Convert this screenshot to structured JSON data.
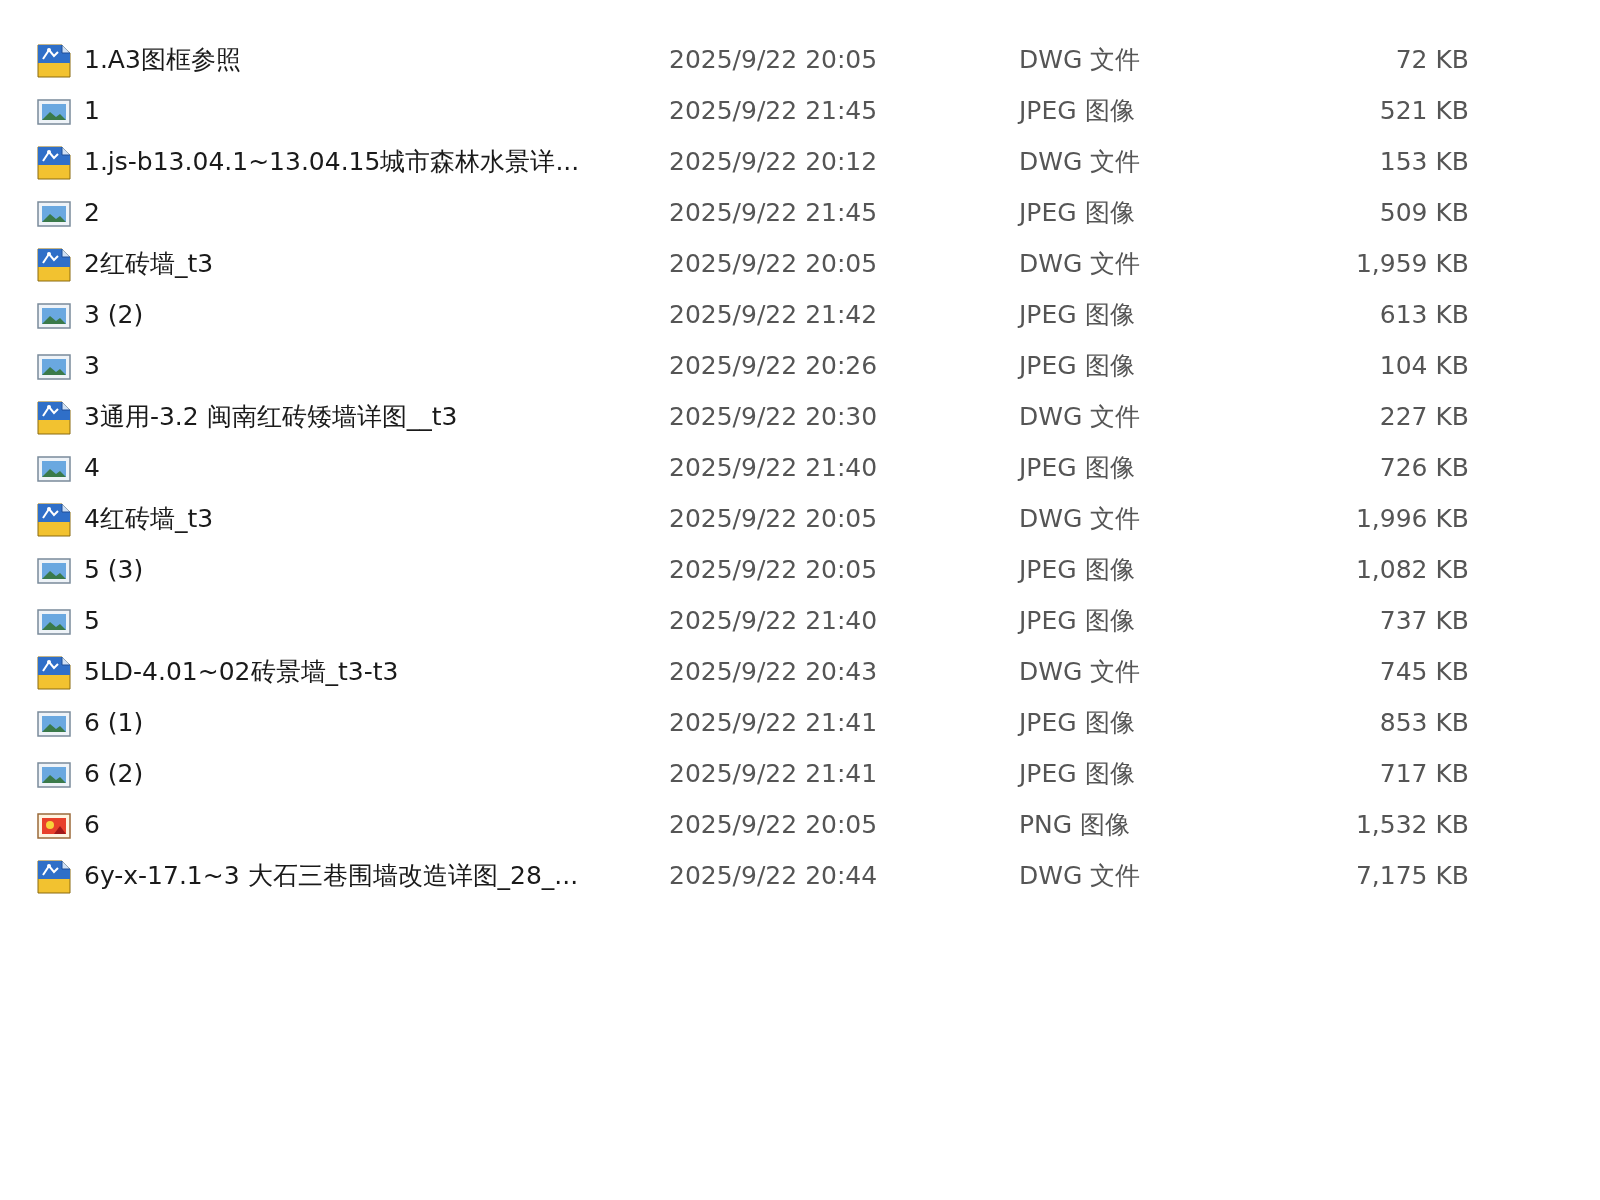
{
  "files": [
    {
      "kind": "dwg",
      "name": "1.A3图框参照",
      "date": "2025/9/22 20:05",
      "type": "DWG 文件",
      "size": "72 KB"
    },
    {
      "kind": "jpeg",
      "name": "1",
      "date": "2025/9/22 21:45",
      "type": "JPEG 图像",
      "size": "521 KB"
    },
    {
      "kind": "dwg",
      "name": "1.js-b13.04.1~13.04.15城市森林水景详...",
      "date": "2025/9/22 20:12",
      "type": "DWG 文件",
      "size": "153 KB"
    },
    {
      "kind": "jpeg",
      "name": "2",
      "date": "2025/9/22 21:45",
      "type": "JPEG 图像",
      "size": "509 KB"
    },
    {
      "kind": "dwg",
      "name": "2红砖墙_t3",
      "date": "2025/9/22 20:05",
      "type": "DWG 文件",
      "size": "1,959 KB"
    },
    {
      "kind": "jpeg",
      "name": "3 (2)",
      "date": "2025/9/22 21:42",
      "type": "JPEG 图像",
      "size": "613 KB"
    },
    {
      "kind": "jpeg",
      "name": "3",
      "date": "2025/9/22 20:26",
      "type": "JPEG 图像",
      "size": "104 KB"
    },
    {
      "kind": "dwg",
      "name": "3通用-3.2 闽南红砖矮墙详图__t3",
      "date": "2025/9/22 20:30",
      "type": "DWG 文件",
      "size": "227 KB"
    },
    {
      "kind": "jpeg",
      "name": "4",
      "date": "2025/9/22 21:40",
      "type": "JPEG 图像",
      "size": "726 KB"
    },
    {
      "kind": "dwg",
      "name": "4红砖墙_t3",
      "date": "2025/9/22 20:05",
      "type": "DWG 文件",
      "size": "1,996 KB"
    },
    {
      "kind": "jpeg",
      "name": "5 (3)",
      "date": "2025/9/22 20:05",
      "type": "JPEG 图像",
      "size": "1,082 KB"
    },
    {
      "kind": "jpeg",
      "name": "5",
      "date": "2025/9/22 21:40",
      "type": "JPEG 图像",
      "size": "737 KB"
    },
    {
      "kind": "dwg",
      "name": "5LD-4.01~02砖景墙_t3-t3",
      "date": "2025/9/22 20:43",
      "type": "DWG 文件",
      "size": "745 KB"
    },
    {
      "kind": "jpeg",
      "name": "6 (1)",
      "date": "2025/9/22 21:41",
      "type": "JPEG 图像",
      "size": "853 KB"
    },
    {
      "kind": "jpeg",
      "name": "6 (2)",
      "date": "2025/9/22 21:41",
      "type": "JPEG 图像",
      "size": "717 KB"
    },
    {
      "kind": "png",
      "name": "6",
      "date": "2025/9/22 20:05",
      "type": "PNG 图像",
      "size": "1,532 KB"
    },
    {
      "kind": "dwg",
      "name": "6y-x-17.1~3 大石三巷围墙改造详图_28_...",
      "date": "2025/9/22 20:44",
      "type": "DWG 文件",
      "size": "7,175 KB"
    }
  ]
}
